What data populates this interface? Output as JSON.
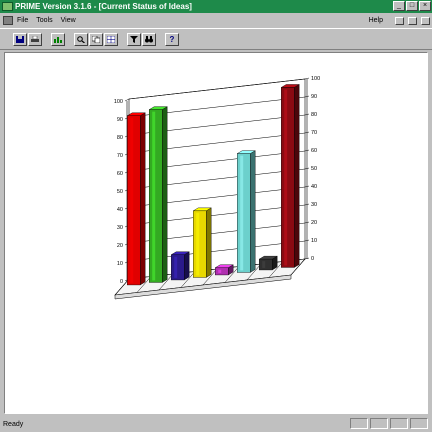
{
  "window": {
    "title": "PRIME Version 3.1.6 - [Current Status of Ideas]"
  },
  "title_buttons": [
    "_",
    "□",
    "×"
  ],
  "menu": {
    "items": [
      "File",
      "Tools",
      "View"
    ],
    "help": "Help"
  },
  "toolbar": {
    "buttons": [
      "save-icon",
      "print-icon",
      "chart-icon",
      "zoom-icon",
      "copy-icon",
      "table-icon",
      "binoculars-icon",
      "help-icon"
    ],
    "help_label": "?"
  },
  "status": {
    "text": "Ready"
  },
  "colors": {
    "titlebar": "#1e8a4a",
    "bars": [
      "#e00000",
      "#33aa22",
      "#2a1a8a",
      "#e8d800",
      "#b030b0",
      "#6cd0cc",
      "#303030",
      "#8a0a12"
    ]
  },
  "chart_data": {
    "type": "bar",
    "view": "3d",
    "ylim": [
      0,
      100
    ],
    "yticks": [
      0,
      10,
      20,
      30,
      40,
      50,
      60,
      70,
      80,
      90,
      100
    ],
    "values": [
      94,
      96,
      14,
      37,
      4,
      66,
      6,
      100
    ],
    "grid": true
  }
}
